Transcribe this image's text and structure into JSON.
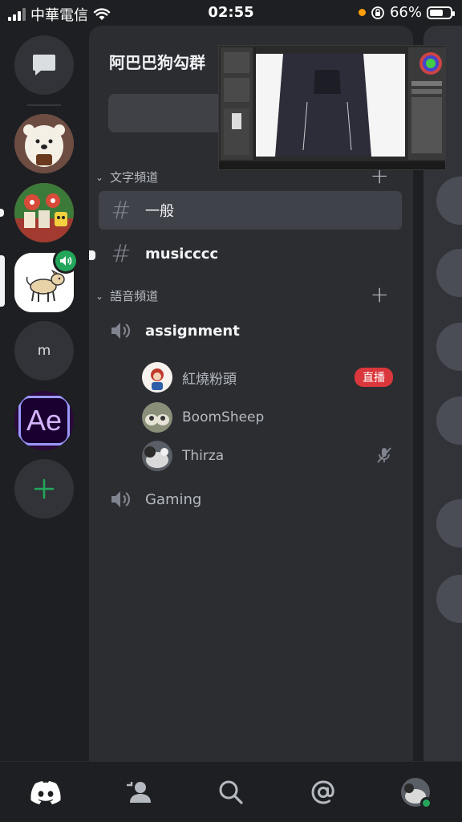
{
  "status_bar": {
    "carrier": "中華電信",
    "time": "02:55",
    "battery": "66%",
    "battery_level": 0.66
  },
  "server_rail": {
    "servers": [
      {
        "name": "direct-messages",
        "icon": "chat-bubble-icon"
      },
      {
        "name": "bear-server",
        "icon": "bear-avatar"
      },
      {
        "name": "cartoon-server",
        "icon": "cartoon-avatar"
      },
      {
        "name": "dog-server",
        "icon": "dog-avatar",
        "selected": true,
        "voice_active": true
      },
      {
        "name": "m-server",
        "label": "m"
      },
      {
        "name": "ae-server",
        "label": "Ae"
      },
      {
        "name": "add-server",
        "icon": "plus-icon"
      }
    ]
  },
  "guild": {
    "title": "阿巴巴狗勾群",
    "text_category": "文字頻道",
    "voice_category": "語音頻道",
    "text_channels": [
      {
        "name": "一般",
        "active": true
      },
      {
        "name": "musicccc",
        "unread": true
      }
    ],
    "voice_channels": [
      {
        "name": "assignment"
      },
      {
        "name": "Gaming"
      }
    ],
    "voice_users": [
      {
        "name": "紅燒粉頭",
        "badge": "直播"
      },
      {
        "name": "BoomSheep"
      },
      {
        "name": "Thirza",
        "muted": true
      }
    ]
  },
  "bottom_nav": {
    "items": [
      "discord-home-icon",
      "friends-icon",
      "search-icon",
      "mentions-icon",
      "profile-avatar"
    ]
  },
  "colors": {
    "accent_green": "#23a55a",
    "live_red": "#da373c",
    "panel_bg": "#2b2d31",
    "rail_bg": "#1e1f22"
  }
}
